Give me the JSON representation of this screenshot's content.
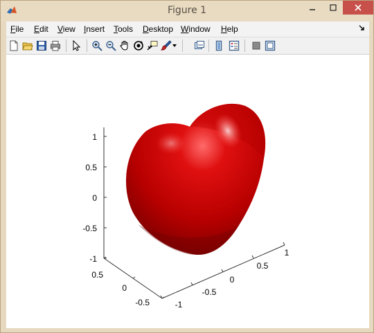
{
  "window": {
    "title": "Figure 1"
  },
  "menus": [
    {
      "key": "F",
      "rest": "ile"
    },
    {
      "key": "E",
      "rest": "dit"
    },
    {
      "key": "V",
      "rest": "iew"
    },
    {
      "key": "I",
      "rest": "nsert"
    },
    {
      "key": "T",
      "rest": "ools"
    },
    {
      "key": "D",
      "rest": "esktop"
    },
    {
      "key": "W",
      "rest": "indow"
    },
    {
      "key": "H",
      "rest": "elp"
    }
  ],
  "toolbar_icons": [
    "new-figure-icon",
    "open-file-icon",
    "save-icon",
    "print-icon",
    "edit-plot-arrow-icon",
    "zoom-in-icon",
    "zoom-out-icon",
    "pan-hand-icon",
    "rotate-3d-icon",
    "data-cursor-icon",
    "brush-icon",
    "brush-dropdown-icon",
    "link-plot-icon",
    "insert-colorbar-icon",
    "insert-legend-icon",
    "hide-plot-tools-icon",
    "show-plot-tools-icon"
  ],
  "axes": {
    "z_ticks": [
      "1",
      "0.5",
      "0",
      "-0.5",
      "-1"
    ],
    "y_ticks": [
      "0.5",
      "0",
      "-0.5"
    ],
    "x_ticks": [
      "-1",
      "-0.5",
      "0",
      "0.5",
      "1"
    ]
  },
  "surface": {
    "color": "#cc0000",
    "shape": "heart"
  }
}
